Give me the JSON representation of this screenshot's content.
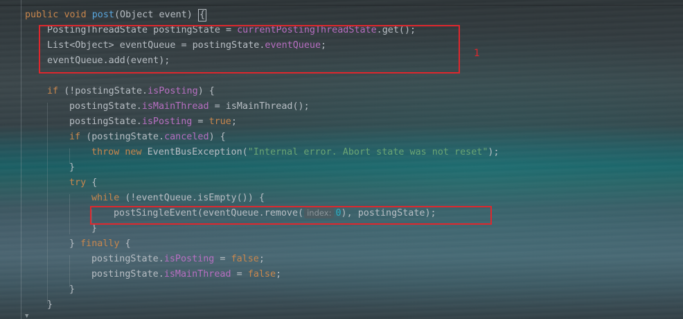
{
  "editor": {
    "annotation_label": "1",
    "lines": [
      {
        "tokens": [
          {
            "t": "public ",
            "c": "kw"
          },
          {
            "t": "void ",
            "c": "kw"
          },
          {
            "t": "post",
            "c": "fn"
          },
          {
            "t": "(Object event) ",
            "c": "id"
          },
          {
            "t": "{",
            "c": "caret"
          }
        ]
      },
      {
        "tokens": [
          {
            "t": "PostingThreadState postingState = ",
            "c": "id"
          },
          {
            "t": "currentPostingThreadState",
            "c": "fld"
          },
          {
            "t": ".get();",
            "c": "id"
          }
        ]
      },
      {
        "tokens": [
          {
            "t": "List<Object> eventQueue = postingState.",
            "c": "id"
          },
          {
            "t": "eventQueue",
            "c": "fld"
          },
          {
            "t": ";",
            "c": "id"
          }
        ]
      },
      {
        "tokens": [
          {
            "t": "eventQueue.add(event);",
            "c": "id"
          }
        ]
      },
      {
        "tokens": []
      },
      {
        "tokens": [
          {
            "t": "if ",
            "c": "kw"
          },
          {
            "t": "(!postingState.",
            "c": "id"
          },
          {
            "t": "isPosting",
            "c": "fld"
          },
          {
            "t": ") {",
            "c": "id"
          }
        ]
      },
      {
        "tokens": [
          {
            "t": "postingState.",
            "c": "id"
          },
          {
            "t": "isMainThread",
            "c": "fld"
          },
          {
            "t": " = isMainThread();",
            "c": "id"
          }
        ]
      },
      {
        "tokens": [
          {
            "t": "postingState.",
            "c": "id"
          },
          {
            "t": "isPosting",
            "c": "fld"
          },
          {
            "t": " = ",
            "c": "id"
          },
          {
            "t": "true",
            "c": "kw"
          },
          {
            "t": ";",
            "c": "id"
          }
        ]
      },
      {
        "tokens": [
          {
            "t": "if ",
            "c": "kw"
          },
          {
            "t": "(postingState.",
            "c": "id"
          },
          {
            "t": "canceled",
            "c": "fld"
          },
          {
            "t": ") {",
            "c": "id"
          }
        ]
      },
      {
        "tokens": [
          {
            "t": "throw ",
            "c": "kw"
          },
          {
            "t": "new ",
            "c": "kw"
          },
          {
            "t": "EventBusException(",
            "c": "id"
          },
          {
            "t": "\"Internal error. Abort state was not reset\"",
            "c": "str"
          },
          {
            "t": ");",
            "c": "id"
          }
        ]
      },
      {
        "tokens": [
          {
            "t": "}",
            "c": "id"
          }
        ]
      },
      {
        "tokens": [
          {
            "t": "try ",
            "c": "kw"
          },
          {
            "t": "{",
            "c": "id"
          }
        ]
      },
      {
        "tokens": [
          {
            "t": "while ",
            "c": "kw"
          },
          {
            "t": "(!eventQueue.isEmpty()) {",
            "c": "id"
          }
        ]
      },
      {
        "tokens": [
          {
            "t": "postSingleEvent(eventQueue.remove(",
            "c": "id"
          },
          {
            "t": "index:",
            "c": "hint"
          },
          {
            "t": "0",
            "c": "num"
          },
          {
            "t": "), postingState);",
            "c": "id"
          }
        ]
      },
      {
        "tokens": [
          {
            "t": "}",
            "c": "id"
          }
        ]
      },
      {
        "tokens": [
          {
            "t": "} ",
            "c": "id"
          },
          {
            "t": "finally ",
            "c": "kw"
          },
          {
            "t": "{",
            "c": "id"
          }
        ]
      },
      {
        "tokens": [
          {
            "t": "postingState.",
            "c": "id"
          },
          {
            "t": "isPosting",
            "c": "fld"
          },
          {
            "t": " = ",
            "c": "id"
          },
          {
            "t": "false",
            "c": "kw"
          },
          {
            "t": ";",
            "c": "id"
          }
        ]
      },
      {
        "tokens": [
          {
            "t": "postingState.",
            "c": "id"
          },
          {
            "t": "isMainThread",
            "c": "fld"
          },
          {
            "t": " = ",
            "c": "id"
          },
          {
            "t": "false",
            "c": "kw"
          },
          {
            "t": ";",
            "c": "id"
          }
        ]
      },
      {
        "tokens": [
          {
            "t": "}",
            "c": "id"
          }
        ]
      },
      {
        "tokens": [
          {
            "t": "}",
            "c": "id"
          }
        ]
      }
    ]
  },
  "colors": {
    "keyword": "#c9874d",
    "method": "#5aa6dd",
    "field": "#b86fc2",
    "string": "#6aa574",
    "number": "#2cb0c6",
    "text": "#b8bec4",
    "highlight_box": "#e0272d"
  }
}
